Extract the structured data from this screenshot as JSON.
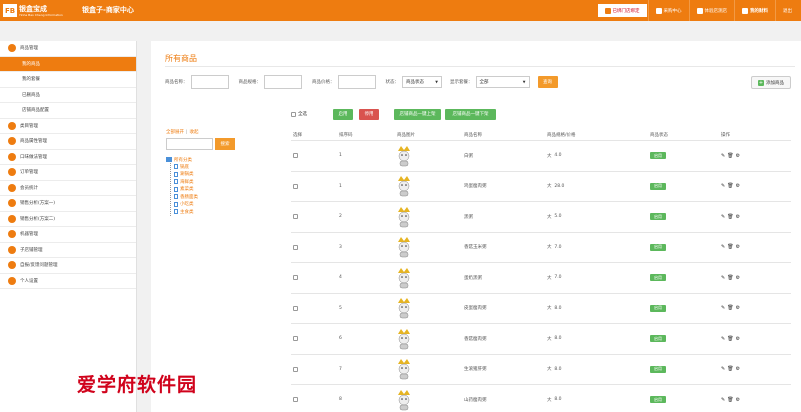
{
  "header": {
    "logo_mark": "FB",
    "logo_cn": "银盒宝成",
    "logo_en": "Yinhe Bao Cheng Information",
    "app_title": "银盒子-商家中心",
    "nav": [
      {
        "label": "已绑门店绑定",
        "icon": "store-icon"
      },
      {
        "label": "采购中心",
        "icon": "cart-icon"
      },
      {
        "label": "体验店测店",
        "icon": "user-icon"
      },
      {
        "label": "我的财料",
        "icon": "fire-icon"
      },
      {
        "label": "退出",
        "icon": ""
      }
    ]
  },
  "sidebar": {
    "items": [
      {
        "label": "商品管理",
        "type": "group"
      },
      {
        "label": "我的商品",
        "type": "sub",
        "active": true
      },
      {
        "label": "我的套餐",
        "type": "sub"
      },
      {
        "label": "已删商品",
        "type": "sub"
      },
      {
        "label": "店铺商品配置",
        "type": "sub"
      },
      {
        "label": "类目管理",
        "type": "group"
      },
      {
        "label": "商品属性管理",
        "type": "group"
      },
      {
        "label": "口味做法管理",
        "type": "group"
      },
      {
        "label": "订单管理",
        "type": "group"
      },
      {
        "label": "会员统计",
        "type": "group"
      },
      {
        "label": "销售分析(方案一)",
        "type": "group"
      },
      {
        "label": "销售分析(方案二)",
        "type": "group"
      },
      {
        "label": "机器管理",
        "type": "group"
      },
      {
        "label": "子店铺管理",
        "type": "group"
      },
      {
        "label": "自报/反馈问题管理",
        "type": "group"
      },
      {
        "label": "个人设置",
        "type": "group"
      }
    ]
  },
  "page": {
    "title": "所有商品",
    "filters": {
      "name_label": "商品名称：",
      "spec_label": "商品规格：",
      "price_label": "商品价格：",
      "status_label": "状态：",
      "status_value": "商品状态",
      "display_label": "显示套餐：",
      "display_value": "全部",
      "query_label": "查询"
    },
    "add_label": "添加商品",
    "actions": {
      "select_all": "全选",
      "enable": "启用",
      "disable": "停用",
      "on_all": "店铺商品一键上架",
      "off_all": "店铺商品一键下架"
    },
    "tree": {
      "expand_all": "全部展开",
      "collapse": "收起",
      "search_label": "搜索",
      "root": "所有分类",
      "children": [
        "锅底",
        "涮锅类",
        "海鲜类",
        "素菜类",
        "香肠面类",
        "小吃类",
        "主食类"
      ]
    },
    "table": {
      "headers": [
        "选择",
        "排序码",
        "商品图片",
        "商品名称",
        "商品规格/价格",
        "商品状态",
        "操作"
      ],
      "rows": [
        {
          "sort": "1",
          "name": "白粥",
          "spec": "大",
          "price": "4.0",
          "status": "启用"
        },
        {
          "sort": "1",
          "name": "鸡蛋瘦肉粥",
          "spec": "大",
          "price": "28.0",
          "status": "启用"
        },
        {
          "sort": "2",
          "name": "黑粥",
          "spec": "大",
          "price": "5.0",
          "status": "启用"
        },
        {
          "sort": "3",
          "name": "香菇玉米粥",
          "spec": "大",
          "price": "7.0",
          "status": "启用"
        },
        {
          "sort": "4",
          "name": "蛋奶黑粥",
          "spec": "大",
          "price": "7.0",
          "status": "启用"
        },
        {
          "sort": "5",
          "name": "皮蛋瘦肉粥",
          "spec": "大",
          "price": "8.0",
          "status": "启用"
        },
        {
          "sort": "6",
          "name": "香菇瘦肉粥",
          "spec": "大",
          "price": "8.0",
          "status": "启用"
        },
        {
          "sort": "7",
          "name": "生滚猪肝粥",
          "spec": "大",
          "price": "8.0",
          "status": "启用"
        },
        {
          "sort": "8",
          "name": "山药瘦肉粥",
          "spec": "大",
          "price": "8.0",
          "status": "启用"
        }
      ]
    }
  },
  "watermark": "爱学府软件园",
  "colors": {
    "accent": "#ee7c10",
    "success": "#5cb85c",
    "danger": "#d9534f"
  }
}
